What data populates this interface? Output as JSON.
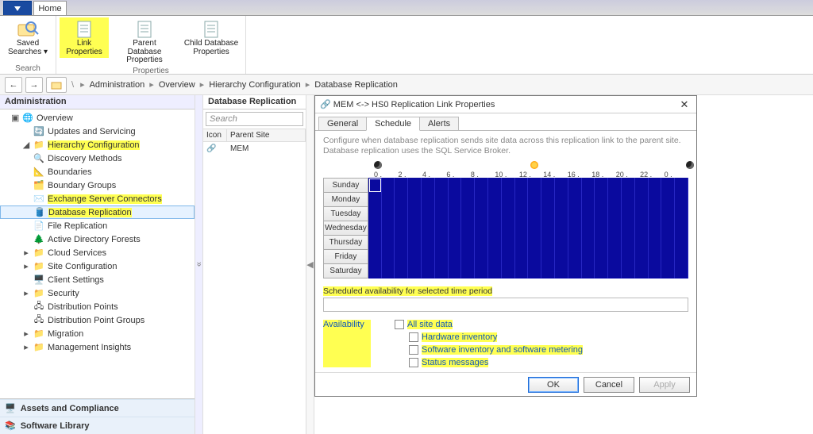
{
  "ribbon": {
    "tabs": {
      "home": "Home"
    },
    "search_group": "Search",
    "props_group": "Properties",
    "saved_searches": "Saved\nSearches ▾",
    "link_props": "Link\nProperties",
    "parent_db_props": "Parent Database\nProperties",
    "child_db_props": "Child Database\nProperties"
  },
  "breadcrumb": [
    "Administration",
    "Overview",
    "Hierarchy Configuration",
    "Database Replication"
  ],
  "admin_header": "Administration",
  "tree": {
    "overview": "Overview",
    "updates": "Updates and Servicing",
    "hier": "Hierarchy Configuration",
    "disc": "Discovery Methods",
    "bound": "Boundaries",
    "boundg": "Boundary Groups",
    "exch": "Exchange Server Connectors",
    "dbrep": "Database Replication",
    "filerep": "File Replication",
    "adf": "Active Directory Forests",
    "cloud": "Cloud Services",
    "siteconf": "Site Configuration",
    "client": "Client Settings",
    "sec": "Security",
    "distp": "Distribution Points",
    "distpg": "Distribution Point Groups",
    "mig": "Migration",
    "mi": "Management Insights"
  },
  "wunderbar": {
    "assets": "Assets and Compliance",
    "swlib": "Software Library"
  },
  "mid": {
    "title": "Database Replication",
    "search": "Search",
    "col_icon": "Icon",
    "col_parent": "Parent Site",
    "row_parent": "MEM"
  },
  "dialog": {
    "title": "MEM <-> HS0 Replication Link Properties",
    "tabs": {
      "general": "General",
      "schedule": "Schedule",
      "alerts": "Alerts"
    },
    "desc": "Configure when database replication sends site data across this replication link to the parent site.  Database replication uses the SQL Service Broker.",
    "axis": [
      "0",
      "2",
      "4",
      "6",
      "8",
      "10",
      "12",
      "14",
      "16",
      "18",
      "20",
      "22",
      "0"
    ],
    "days": [
      "Sunday",
      "Monday",
      "Tuesday",
      "Wednesday",
      "Thursday",
      "Friday",
      "Saturday"
    ],
    "sel_period": "Scheduled availability for selected time period",
    "avail": "Availability",
    "opts": {
      "all": "All site data",
      "hw": "Hardware inventory",
      "sw": "Software inventory and software metering",
      "status": "Status messages"
    },
    "ok": "OK",
    "cancel": "Cancel",
    "apply": "Apply"
  }
}
